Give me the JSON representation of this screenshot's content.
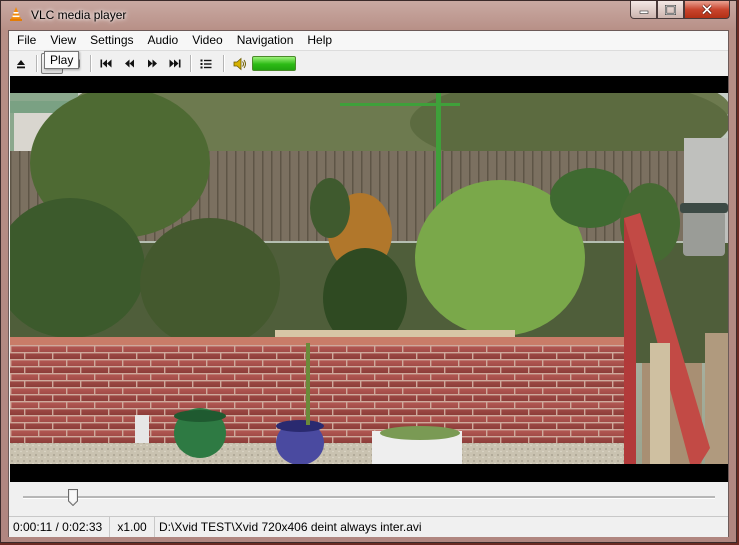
{
  "window": {
    "title": "VLC media player",
    "controls": [
      "minimize-icon",
      "maximize-icon",
      "close-icon"
    ]
  },
  "menubar": {
    "items": [
      "File",
      "View",
      "Settings",
      "Audio",
      "Video",
      "Navigation",
      "Help"
    ]
  },
  "toolbar": {
    "buttons": [
      "eject-icon",
      "play-icon",
      "stop-icon",
      "skip-back-icon",
      "rewind-icon",
      "fast-forward-icon",
      "skip-forward-icon",
      "playlist-icon",
      "speaker-icon"
    ],
    "volume_fraction": 1.0,
    "tooltip": "Play"
  },
  "seek": {
    "position_fraction": 0.072
  },
  "status": {
    "time": "0:00:11 / 0:02:33",
    "rate": "x1.00",
    "file": "D:\\Xvid TEST\\Xvid 720x406 deint always inter.avi"
  },
  "colors": {
    "volume_green": "#2dbb16",
    "close_red": "#c9452e"
  }
}
